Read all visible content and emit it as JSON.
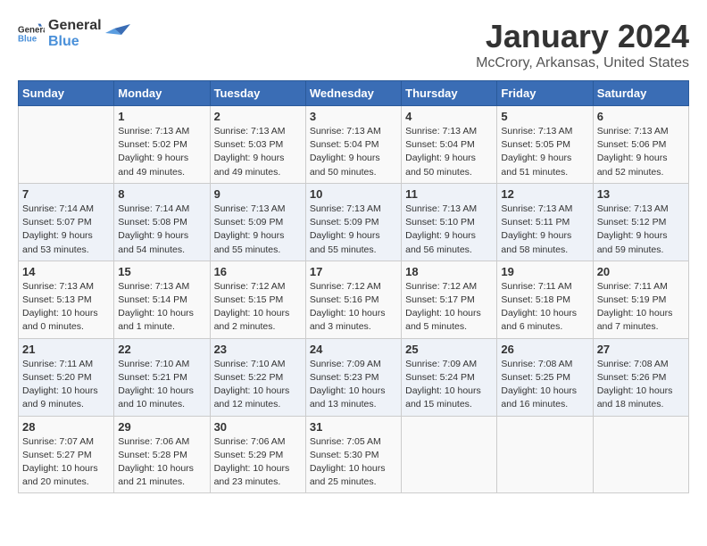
{
  "logo": {
    "general": "General",
    "blue": "Blue"
  },
  "title": "January 2024",
  "subtitle": "McCrory, Arkansas, United States",
  "days_of_week": [
    "Sunday",
    "Monday",
    "Tuesday",
    "Wednesday",
    "Thursday",
    "Friday",
    "Saturday"
  ],
  "weeks": [
    [
      {
        "day": "",
        "content": ""
      },
      {
        "day": "1",
        "content": "Sunrise: 7:13 AM\nSunset: 5:02 PM\nDaylight: 9 hours\nand 49 minutes."
      },
      {
        "day": "2",
        "content": "Sunrise: 7:13 AM\nSunset: 5:03 PM\nDaylight: 9 hours\nand 49 minutes."
      },
      {
        "day": "3",
        "content": "Sunrise: 7:13 AM\nSunset: 5:04 PM\nDaylight: 9 hours\nand 50 minutes."
      },
      {
        "day": "4",
        "content": "Sunrise: 7:13 AM\nSunset: 5:04 PM\nDaylight: 9 hours\nand 50 minutes."
      },
      {
        "day": "5",
        "content": "Sunrise: 7:13 AM\nSunset: 5:05 PM\nDaylight: 9 hours\nand 51 minutes."
      },
      {
        "day": "6",
        "content": "Sunrise: 7:13 AM\nSunset: 5:06 PM\nDaylight: 9 hours\nand 52 minutes."
      }
    ],
    [
      {
        "day": "7",
        "content": "Sunrise: 7:14 AM\nSunset: 5:07 PM\nDaylight: 9 hours\nand 53 minutes."
      },
      {
        "day": "8",
        "content": "Sunrise: 7:14 AM\nSunset: 5:08 PM\nDaylight: 9 hours\nand 54 minutes."
      },
      {
        "day": "9",
        "content": "Sunrise: 7:13 AM\nSunset: 5:09 PM\nDaylight: 9 hours\nand 55 minutes."
      },
      {
        "day": "10",
        "content": "Sunrise: 7:13 AM\nSunset: 5:09 PM\nDaylight: 9 hours\nand 55 minutes."
      },
      {
        "day": "11",
        "content": "Sunrise: 7:13 AM\nSunset: 5:10 PM\nDaylight: 9 hours\nand 56 minutes."
      },
      {
        "day": "12",
        "content": "Sunrise: 7:13 AM\nSunset: 5:11 PM\nDaylight: 9 hours\nand 58 minutes."
      },
      {
        "day": "13",
        "content": "Sunrise: 7:13 AM\nSunset: 5:12 PM\nDaylight: 9 hours\nand 59 minutes."
      }
    ],
    [
      {
        "day": "14",
        "content": "Sunrise: 7:13 AM\nSunset: 5:13 PM\nDaylight: 10 hours\nand 0 minutes."
      },
      {
        "day": "15",
        "content": "Sunrise: 7:13 AM\nSunset: 5:14 PM\nDaylight: 10 hours\nand 1 minute."
      },
      {
        "day": "16",
        "content": "Sunrise: 7:12 AM\nSunset: 5:15 PM\nDaylight: 10 hours\nand 2 minutes."
      },
      {
        "day": "17",
        "content": "Sunrise: 7:12 AM\nSunset: 5:16 PM\nDaylight: 10 hours\nand 3 minutes."
      },
      {
        "day": "18",
        "content": "Sunrise: 7:12 AM\nSunset: 5:17 PM\nDaylight: 10 hours\nand 5 minutes."
      },
      {
        "day": "19",
        "content": "Sunrise: 7:11 AM\nSunset: 5:18 PM\nDaylight: 10 hours\nand 6 minutes."
      },
      {
        "day": "20",
        "content": "Sunrise: 7:11 AM\nSunset: 5:19 PM\nDaylight: 10 hours\nand 7 minutes."
      }
    ],
    [
      {
        "day": "21",
        "content": "Sunrise: 7:11 AM\nSunset: 5:20 PM\nDaylight: 10 hours\nand 9 minutes."
      },
      {
        "day": "22",
        "content": "Sunrise: 7:10 AM\nSunset: 5:21 PM\nDaylight: 10 hours\nand 10 minutes."
      },
      {
        "day": "23",
        "content": "Sunrise: 7:10 AM\nSunset: 5:22 PM\nDaylight: 10 hours\nand 12 minutes."
      },
      {
        "day": "24",
        "content": "Sunrise: 7:09 AM\nSunset: 5:23 PM\nDaylight: 10 hours\nand 13 minutes."
      },
      {
        "day": "25",
        "content": "Sunrise: 7:09 AM\nSunset: 5:24 PM\nDaylight: 10 hours\nand 15 minutes."
      },
      {
        "day": "26",
        "content": "Sunrise: 7:08 AM\nSunset: 5:25 PM\nDaylight: 10 hours\nand 16 minutes."
      },
      {
        "day": "27",
        "content": "Sunrise: 7:08 AM\nSunset: 5:26 PM\nDaylight: 10 hours\nand 18 minutes."
      }
    ],
    [
      {
        "day": "28",
        "content": "Sunrise: 7:07 AM\nSunset: 5:27 PM\nDaylight: 10 hours\nand 20 minutes."
      },
      {
        "day": "29",
        "content": "Sunrise: 7:06 AM\nSunset: 5:28 PM\nDaylight: 10 hours\nand 21 minutes."
      },
      {
        "day": "30",
        "content": "Sunrise: 7:06 AM\nSunset: 5:29 PM\nDaylight: 10 hours\nand 23 minutes."
      },
      {
        "day": "31",
        "content": "Sunrise: 7:05 AM\nSunset: 5:30 PM\nDaylight: 10 hours\nand 25 minutes."
      },
      {
        "day": "",
        "content": ""
      },
      {
        "day": "",
        "content": ""
      },
      {
        "day": "",
        "content": ""
      }
    ]
  ]
}
